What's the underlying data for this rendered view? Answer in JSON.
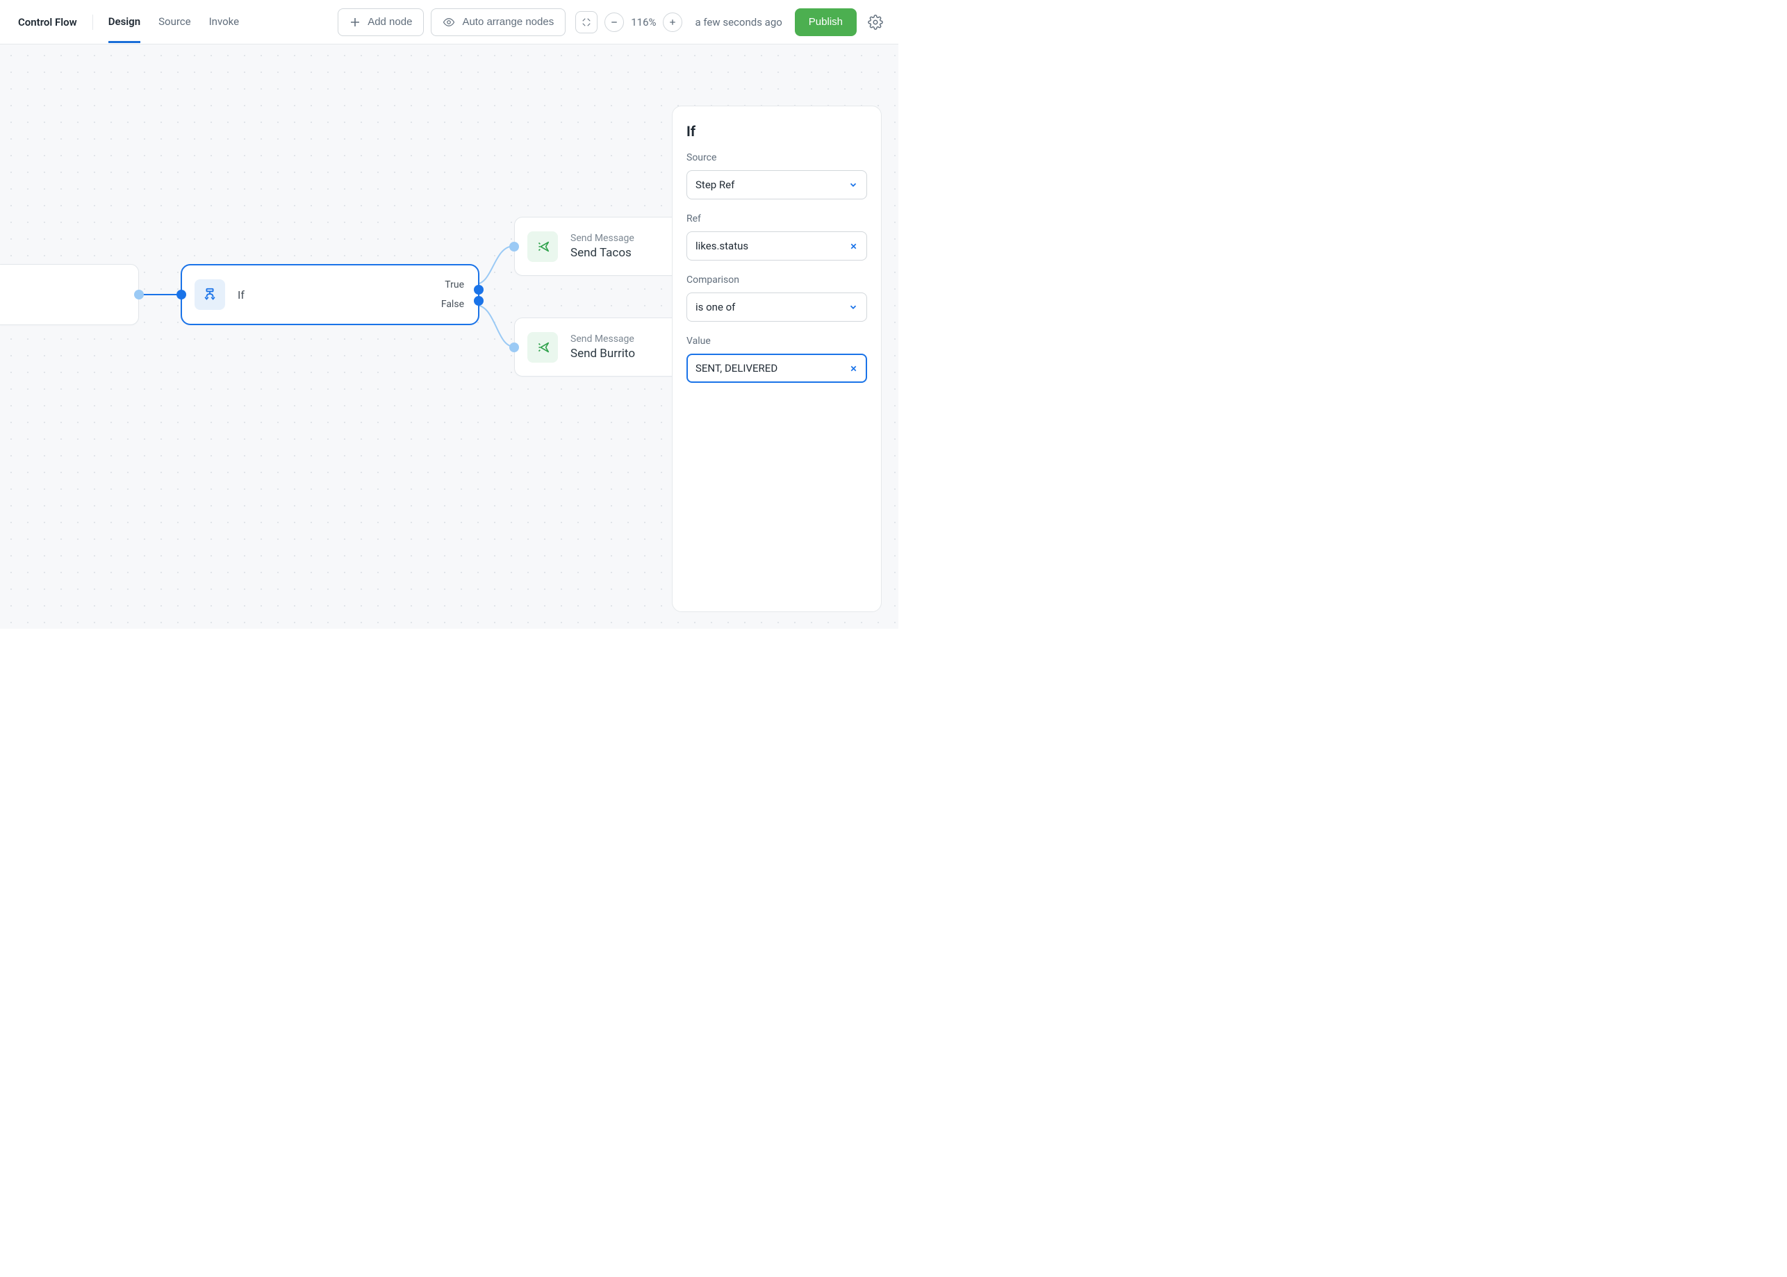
{
  "header": {
    "app_title": "Control Flow",
    "tabs": [
      {
        "id": "design",
        "label": "Design",
        "active": true
      },
      {
        "id": "source",
        "label": "Source",
        "active": false
      },
      {
        "id": "invoke",
        "label": "Invoke",
        "active": false
      }
    ],
    "add_node_label": "Add node",
    "auto_arrange_label": "Auto arrange nodes",
    "zoom_level": "116%",
    "timestamp": "a few seconds ago",
    "publish_label": "Publish"
  },
  "canvas": {
    "if_node": {
      "label": "If",
      "true_label": "True",
      "false_label": "False"
    },
    "msg_true": {
      "type_label": "Send Message",
      "title": "Send Tacos"
    },
    "msg_false": {
      "type_label": "Send Message",
      "title": "Send Burrito"
    }
  },
  "panel": {
    "title": "If",
    "source_label": "Source",
    "source_value": "Step Ref",
    "ref_label": "Ref",
    "ref_value": "likes.status",
    "comparison_label": "Comparison",
    "comparison_value": "is one of",
    "value_label": "Value",
    "value_value": "SENT, DELIVERED"
  }
}
